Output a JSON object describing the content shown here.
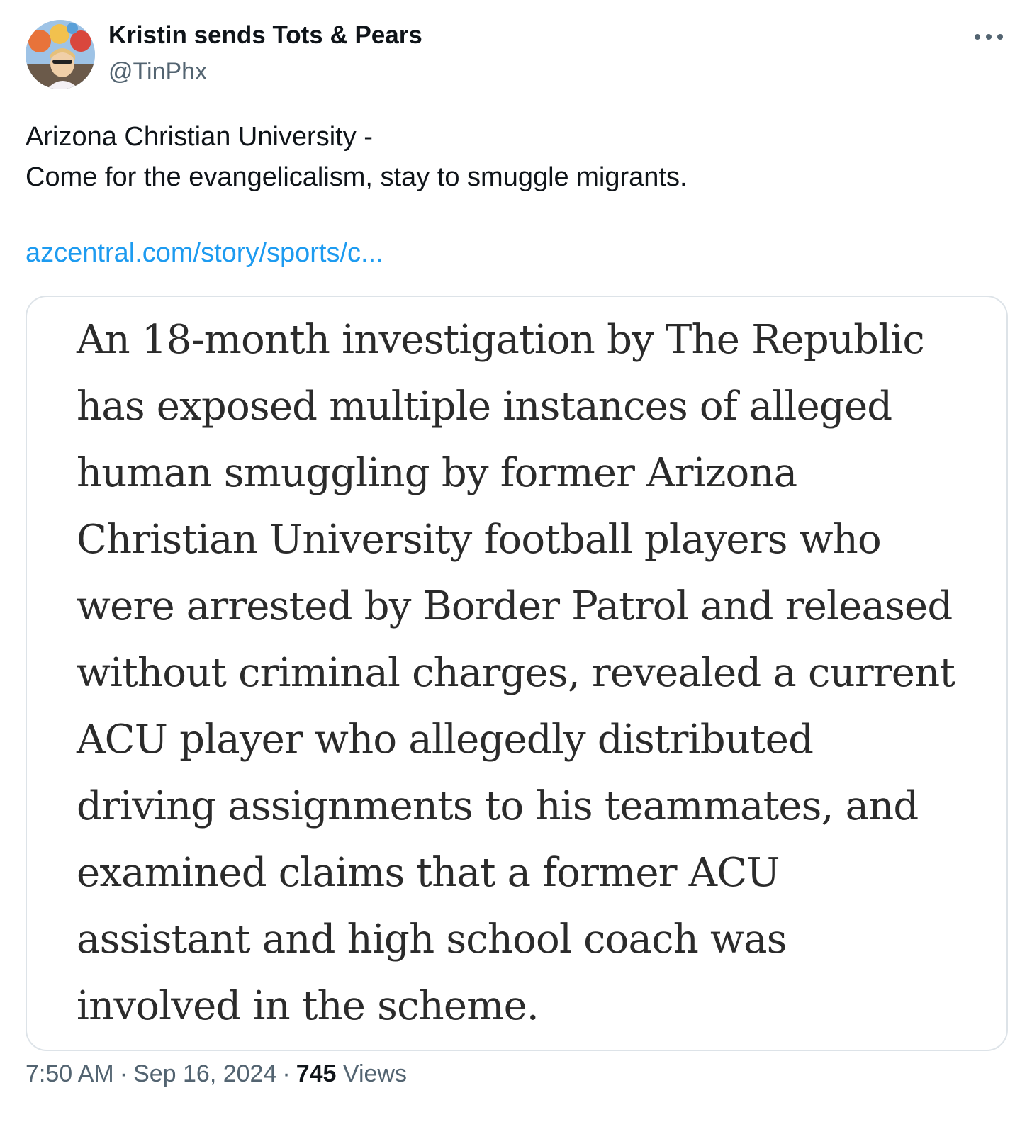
{
  "author": {
    "display_name": "Kristin sends Tots & Pears",
    "handle": "@TinPhx",
    "avatar_icon": "profile-photo-hot-air-balloons"
  },
  "more_icon": "more-horizontal-icon",
  "tweet": {
    "text_lines": [
      "Arizona Christian University -",
      "Come for the evangelicalism, stay to smuggle migrants."
    ],
    "link": "azcentral.com/story/sports/c..."
  },
  "article_image": {
    "lines": [
      "An 18-month investigation by The Republic",
      "has exposed multiple instances of alleged",
      "human smuggling by former Arizona",
      "Christian University football players who",
      "were arrested by Border Patrol and released",
      "without criminal charges, revealed a current",
      "ACU player who allegedly distributed",
      "driving assignments to his teammates, and",
      "examined claims that a former ACU",
      "assistant and high school coach was",
      "involved in the scheme."
    ]
  },
  "meta": {
    "time": "7:50 AM",
    "separator": "·",
    "date": "Sep 16, 2024",
    "views_count": "745",
    "views_label": "Views"
  },
  "colors": {
    "text_primary": "#0f1419",
    "text_secondary": "#536471",
    "link": "#1d9bf0",
    "card_border": "#dde3e8"
  }
}
